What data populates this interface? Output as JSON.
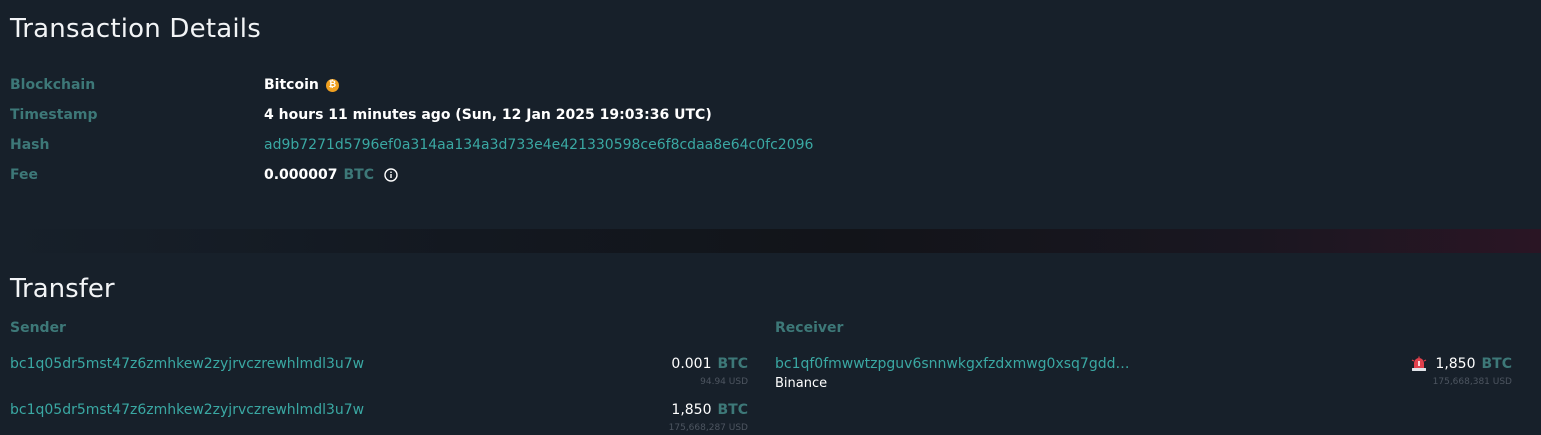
{
  "details": {
    "title": "Transaction Details",
    "rows": {
      "blockchain": {
        "label": "Blockchain",
        "value": "Bitcoin"
      },
      "timestamp": {
        "label": "Timestamp",
        "value": "4 hours 11 minutes ago (Sun, 12 Jan 2025 19:03:36 UTC)"
      },
      "hash": {
        "label": "Hash",
        "value": "ad9b7271d5796ef0a314aa134a3d733e4e421330598ce6f8cdaa8e64c0fc2096"
      },
      "fee": {
        "label": "Fee",
        "value": "0.000007",
        "unit": "BTC"
      }
    }
  },
  "transfer": {
    "title": "Transfer",
    "sender_header": "Sender",
    "receiver_header": "Receiver",
    "senders": [
      {
        "address": "bc1q05dr5mst47z6zmhkew2zyjrvczrewhlmdl3u7w",
        "amount": "0.001",
        "unit": "BTC",
        "usd": "94.94 USD"
      },
      {
        "address": "bc1q05dr5mst47z6zmhkew2zyjrvczrewhlmdl3u7w",
        "amount": "1,850",
        "unit": "BTC",
        "usd": "175,668,287 USD"
      }
    ],
    "receivers": [
      {
        "address": "bc1qf0fmwwtzpguv6snnwkgxfzdxmwg0xsq7gdd…",
        "entity": "Binance",
        "amount": "1,850",
        "unit": "BTC",
        "usd": "175,668,381 USD"
      }
    ]
  },
  "colors": {
    "background": "#17202a",
    "label": "#3d7878",
    "link": "#3aa8a3",
    "btc_orange": "#f0a020"
  },
  "icons": {
    "blockchain": "bitcoin-icon",
    "fee_info": "info-icon",
    "receiver_alert": "alert-siren-icon"
  }
}
